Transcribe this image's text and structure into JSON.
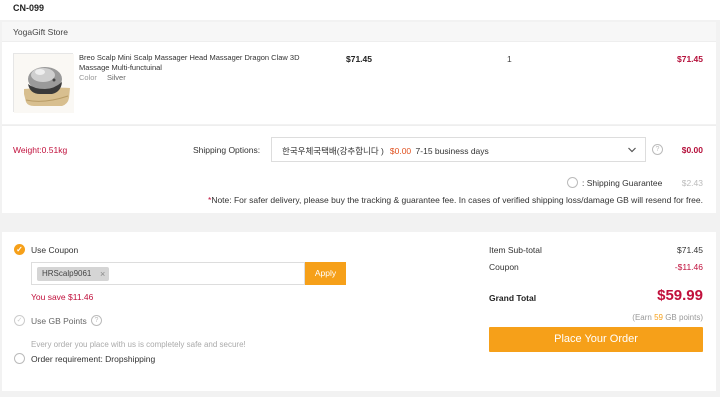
{
  "order": {
    "id": "CN-099"
  },
  "store": {
    "name": "YogaGift Store"
  },
  "product": {
    "title": "Breo Scalp Mini Scalp Massager Head Massager Dragon Claw 3D Massage Multi-functuinal",
    "color_label": "Color",
    "color_value": "Silver",
    "unit_price": "$71.45",
    "quantity": "1",
    "line_total": "$71.45"
  },
  "shipping": {
    "weight": "Weight:0.51kg",
    "label": "Shipping Options:",
    "method_name": "한국우체국택배(강추합니다 )",
    "method_price": "$0.00",
    "method_days": "7-15 business days",
    "cost": "$0.00",
    "guarantee_label": ": Shipping Guarantee",
    "guarantee_price": "$2.43",
    "note_star": "*",
    "note_text": "Note: For safer delivery, please buy the tracking & guarantee fee. In cases of verified shipping loss/damage GB will resend for free."
  },
  "coupon": {
    "label": "Use Coupon",
    "code": "HRScalp9061",
    "apply_label": "Apply",
    "savings": "You save $11.46"
  },
  "gb_points": {
    "label": "Use GB Points"
  },
  "safe_text": "Every order you place with us is completely safe and secure!",
  "order_requirement": "Order requirement: Dropshipping",
  "summary": {
    "subtotal_label": "Item Sub-total",
    "subtotal": "$71.45",
    "coupon_label": "Coupon",
    "coupon": "-$11.46",
    "grand_label": "Grand Total",
    "grand_total": "$59.99",
    "earn_prefix": "(Earn ",
    "earn_points": "59",
    "earn_suffix": " GB points)",
    "place_order": "Place Your Order"
  },
  "colors": {
    "accent": "#f6a019",
    "price": "#b5103b"
  },
  "icons": {
    "check": "check-circle-icon",
    "help": "question-circle-icon",
    "chevron": "chevron-down-icon",
    "remove": "close-icon"
  }
}
